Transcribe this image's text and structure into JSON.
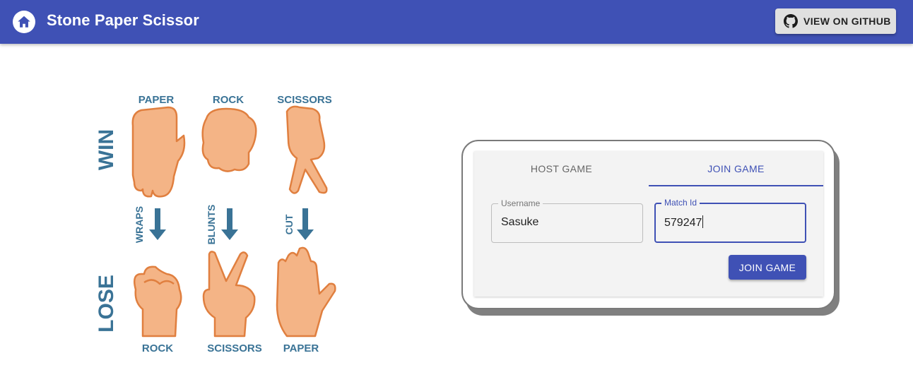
{
  "header": {
    "title": "Stone Paper Scissor",
    "home_icon": "home-icon",
    "github_button_label": "VIEW ON GITHUB",
    "github_icon": "github-icon",
    "bar_color": "#3f51b5"
  },
  "rules_image": {
    "win_label": "WIN",
    "lose_label": "LOSE",
    "top_labels": [
      "PAPER",
      "ROCK",
      "SCISSORS"
    ],
    "verbs": [
      "WRAPS",
      "BLUNTS",
      "CUT"
    ],
    "bottom_labels": [
      "ROCK",
      "SCISSORS",
      "PAPER"
    ]
  },
  "game_panel": {
    "tabs": [
      {
        "label": "HOST GAME",
        "selected": false
      },
      {
        "label": "JOIN GAME",
        "selected": true
      }
    ],
    "username": {
      "label": "Username",
      "value": "Sasuke"
    },
    "match_id": {
      "label": "Match Id",
      "value": "579247"
    },
    "join_button_label": "JOIN GAME"
  }
}
